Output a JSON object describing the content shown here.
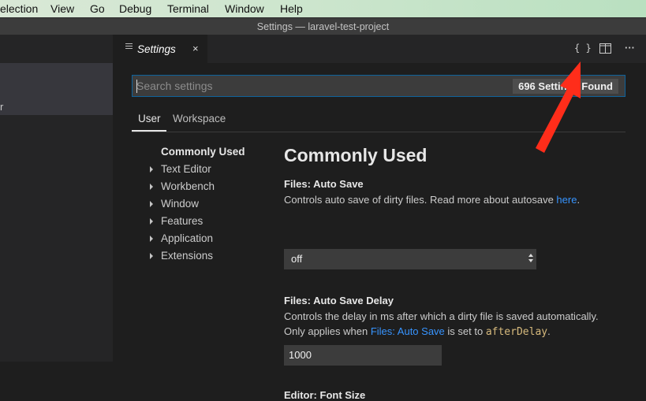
{
  "menubar": {
    "items": [
      "election",
      "View",
      "Go",
      "Debug",
      "Terminal",
      "Window",
      "Help"
    ]
  },
  "window": {
    "title": "Settings — laravel-test-project"
  },
  "sidebar": {
    "fragment": "r"
  },
  "tab": {
    "label": "Settings",
    "close": "×"
  },
  "actions": {
    "open_json": "{ }",
    "split": "split-editor-icon",
    "more": "···"
  },
  "search": {
    "placeholder": "Search settings",
    "count_badge": "696 Settings Found"
  },
  "scopes": {
    "user": "User",
    "workspace": "Workspace"
  },
  "toc": {
    "active": "Commonly Used",
    "items": [
      "Text Editor",
      "Workbench",
      "Window",
      "Features",
      "Application",
      "Extensions"
    ]
  },
  "content": {
    "section_title": "Commonly Used",
    "auto_save": {
      "prefix": "Files: ",
      "name": "Auto Save",
      "desc_before": "Controls auto save of dirty files. Read more about autosave ",
      "desc_link": "here",
      "desc_after": ".",
      "value": "off"
    },
    "auto_save_delay": {
      "prefix": "Files: ",
      "name": "Auto Save Delay",
      "desc_line1": "Controls the delay in ms after which a dirty file is saved automatically.",
      "desc_line2_before": "Only applies when ",
      "desc_line2_link": "Files: Auto Save",
      "desc_line2_mid": " is set to ",
      "desc_line2_code": "afterDelay",
      "desc_line2_after": ".",
      "value": "1000"
    },
    "font_size": {
      "prefix": "Editor: ",
      "name": "Font Size"
    }
  },
  "colors": {
    "annotation_arrow": "#ff2d1a",
    "focus_border": "#0e639c",
    "link": "#3794ff"
  }
}
